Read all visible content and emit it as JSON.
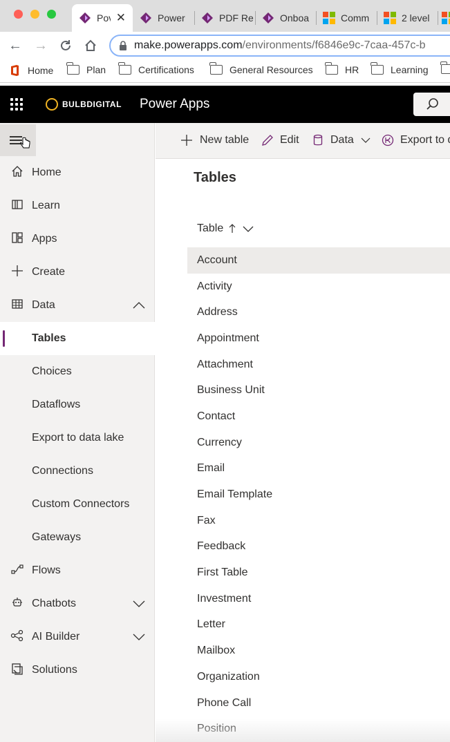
{
  "browser": {
    "tabs": [
      {
        "label": "Pov",
        "active": true
      },
      {
        "label": "Power"
      },
      {
        "label": "PDF Re"
      },
      {
        "label": "Onboa"
      },
      {
        "label": "Comm"
      },
      {
        "label": "2 level"
      }
    ],
    "url_host": "make.powerapps.com",
    "url_path": "/environments/f6846e9c-7caa-457c-b",
    "bookmarks": [
      "Home",
      "Plan",
      "Certifications",
      "General Resources",
      "HR",
      "Learning"
    ]
  },
  "header": {
    "brand": "BULBDIGITAL",
    "product": "Power Apps"
  },
  "nav": {
    "items": [
      {
        "label": "Home",
        "icon": "home-icon"
      },
      {
        "label": "Learn",
        "icon": "book-icon"
      },
      {
        "label": "Apps",
        "icon": "apps-icon"
      },
      {
        "label": "Create",
        "icon": "plus-icon"
      },
      {
        "label": "Data",
        "icon": "table-icon",
        "expanded": true
      },
      {
        "label": "Tables",
        "selected": true
      },
      {
        "label": "Choices"
      },
      {
        "label": "Dataflows"
      },
      {
        "label": "Export to data lake"
      },
      {
        "label": "Connections"
      },
      {
        "label": "Custom Connectors"
      },
      {
        "label": "Gateways"
      },
      {
        "label": "Flows",
        "icon": "flow-icon"
      },
      {
        "label": "Chatbots",
        "icon": "bot-icon",
        "collapsible": true
      },
      {
        "label": "AI Builder",
        "icon": "ai-icon",
        "collapsible": true
      },
      {
        "label": "Solutions",
        "icon": "solutions-icon"
      }
    ]
  },
  "commands": {
    "new_table": "New table",
    "edit": "Edit",
    "data": "Data",
    "export": "Export to d"
  },
  "main": {
    "title": "Tables",
    "column_header": "Table",
    "rows": [
      "Account",
      "Activity",
      "Address",
      "Appointment",
      "Attachment",
      "Business Unit",
      "Contact",
      "Currency",
      "Email",
      "Email Template",
      "Fax",
      "Feedback",
      "First Table",
      "Investment",
      "Letter",
      "Mailbox",
      "Organization",
      "Phone Call",
      "Position"
    ]
  },
  "colors": {
    "accent": "#742774",
    "appbar": "#000000",
    "nav_bg": "#f3f2f1"
  }
}
